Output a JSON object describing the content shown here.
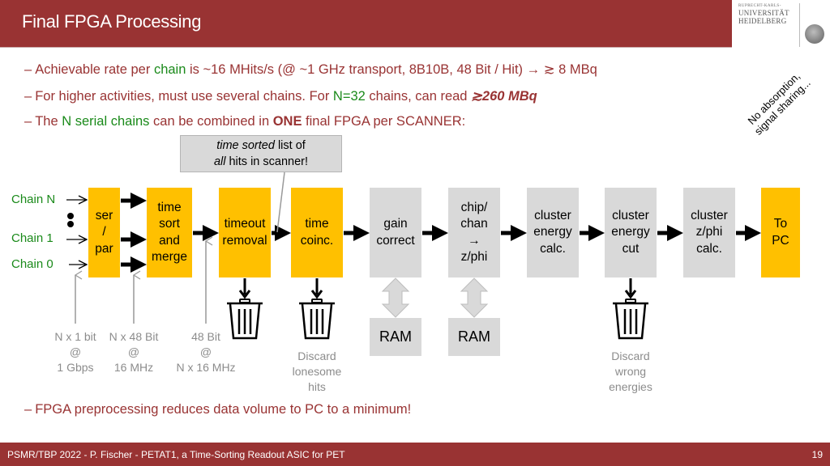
{
  "header": {
    "title": "Final FPGA Processing",
    "logo": {
      "small_text": "RUPRECHT-KARLS-",
      "line1": "UNIVERSITÄT",
      "line2": "HEIDELBERG",
      "seal_icon": "university-seal-icon"
    }
  },
  "bullets": [
    {
      "dash": "–",
      "parts": {
        "a": "Achievable rate per ",
        "b_green": "chain",
        "c": " is ~16 MHits/s  (@ ~1 GHz transport, 8B10B, 48 Bit / Hit) → ≳ 8 MBq"
      }
    },
    {
      "dash": "–",
      "parts": {
        "a": "For higher activities, must use several chains. For ",
        "b_green": "N=32",
        "c": " chains, can read ",
        "d_bolditalic": "≳260 MBq"
      }
    },
    {
      "dash": "–",
      "parts": {
        "a": "The ",
        "b_green": "N serial chains",
        "c": " can be combined in ",
        "d_bold": "ONE",
        "e": " final FPGA per SCANNER:"
      }
    }
  ],
  "rotated_note": {
    "line1": "No absorption,",
    "line2": "signal sharing..."
  },
  "callout": {
    "line1_italic": "time sorted",
    "line1_rest": " list of",
    "line2_italic": "all",
    "line2_rest": " hits in scanner!"
  },
  "chains": {
    "n": "Chain N",
    "one": "Chain 1",
    "zero": "Chain 0"
  },
  "pipeline": [
    {
      "id": "ser-par",
      "lines": [
        "ser",
        "/",
        "par"
      ],
      "color": "#ffc000"
    },
    {
      "id": "time-sort-merge",
      "lines": [
        "time",
        "sort",
        "and",
        "merge"
      ],
      "color": "#ffc000"
    },
    {
      "id": "timeout-removal",
      "lines": [
        "timeout",
        "removal"
      ],
      "color": "#ffc000"
    },
    {
      "id": "time-coinc",
      "lines": [
        "time",
        "coinc."
      ],
      "color": "#ffc000"
    },
    {
      "id": "gain-correct",
      "lines": [
        "gain",
        "correct"
      ],
      "color": "#d9d9d9"
    },
    {
      "id": "chip-chan-zphi",
      "lines": [
        "chip/",
        "chan",
        "→",
        "z/phi"
      ],
      "color": "#d9d9d9"
    },
    {
      "id": "cluster-energy-calc",
      "lines": [
        "cluster",
        "energy",
        "calc."
      ],
      "color": "#d9d9d9"
    },
    {
      "id": "cluster-energy-cut",
      "lines": [
        "cluster",
        "energy",
        "cut"
      ],
      "color": "#d9d9d9"
    },
    {
      "id": "cluster-zphi-calc",
      "lines": [
        "cluster",
        "z/phi",
        "calc."
      ],
      "color": "#d9d9d9"
    },
    {
      "id": "to-pc",
      "lines": [
        "To",
        "PC"
      ],
      "color": "#ffc000"
    }
  ],
  "ram": [
    "RAM",
    "RAM"
  ],
  "rate_notes": [
    {
      "lines": [
        "N x 1 bit",
        "@",
        "1 Gbps"
      ]
    },
    {
      "lines": [
        "N x 48 Bit",
        "@",
        "16 MHz"
      ]
    },
    {
      "lines": [
        "48 Bit",
        "@",
        "N x 16 MHz"
      ]
    }
  ],
  "discard_notes": [
    {
      "lines": [
        "Discard",
        "lonesome",
        "hits"
      ]
    },
    {
      "lines": [
        "Discard",
        "wrong",
        "energies"
      ]
    }
  ],
  "bottom_bullet": {
    "dash": "–",
    "text": "FPGA preprocessing reduces data volume to PC to a minimum!"
  },
  "footer": {
    "text": "PSMR/TBP 2022  -  P. Fischer  -   PETAT1, a Time-Sorting Readout ASIC for PET",
    "page_number": "19"
  },
  "colors": {
    "brand_red": "#993333",
    "accent_green": "#1a8a1a",
    "fpga_yellow": "#ffc000",
    "block_gray": "#d9d9d9",
    "note_gray": "#8c8c8c"
  }
}
